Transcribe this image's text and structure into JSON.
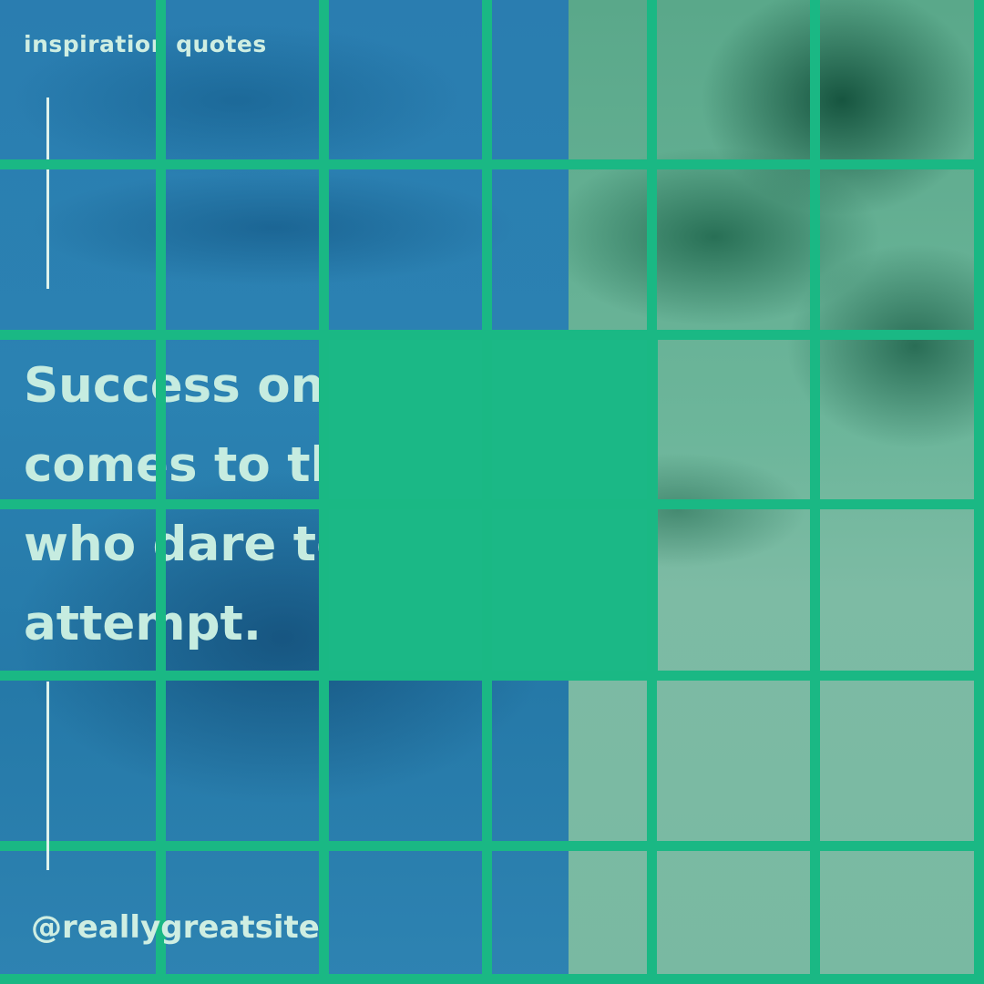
{
  "header": {
    "tag": "inspiration quotes"
  },
  "quote": {
    "lines": [
      "Success only",
      "comes to those",
      "who dare to",
      "attempt."
    ]
  },
  "footer": {
    "handle": "@reallygreatsite"
  },
  "colors": {
    "grid_green": "#1ab884",
    "blue_overlay": "#2d82ad",
    "green_overlay": "#6db69b",
    "text_light": "#cfeee2"
  }
}
